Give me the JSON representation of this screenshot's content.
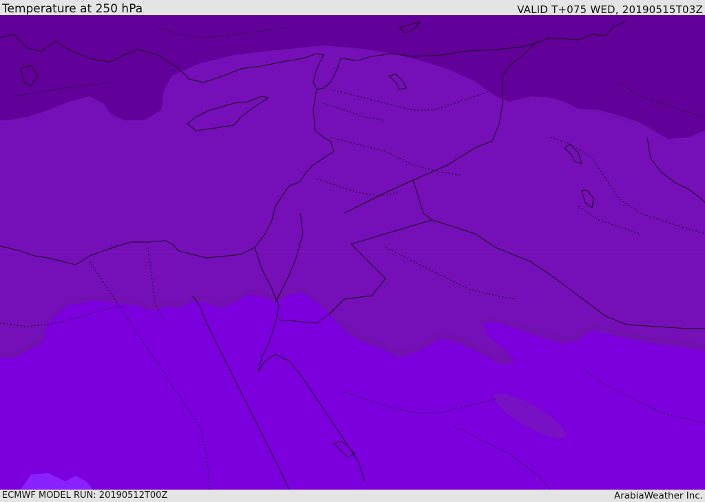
{
  "header": {
    "title": "Temperature at 250 hPa",
    "valid": "VALID T+075 WED, 20190515T03Z"
  },
  "footer": {
    "model_run": "ECMWF MODEL RUN: 20190512T00Z",
    "credit": "ArabiaWeather Inc."
  },
  "colors": {
    "band_coldest": "#62009a",
    "band_cold": "#7210b0",
    "band_mid": "#7a0ec8",
    "band_warm": "#7c00de",
    "band_warmest": "#8a20ff",
    "coastline": "#1a0a1a"
  }
}
